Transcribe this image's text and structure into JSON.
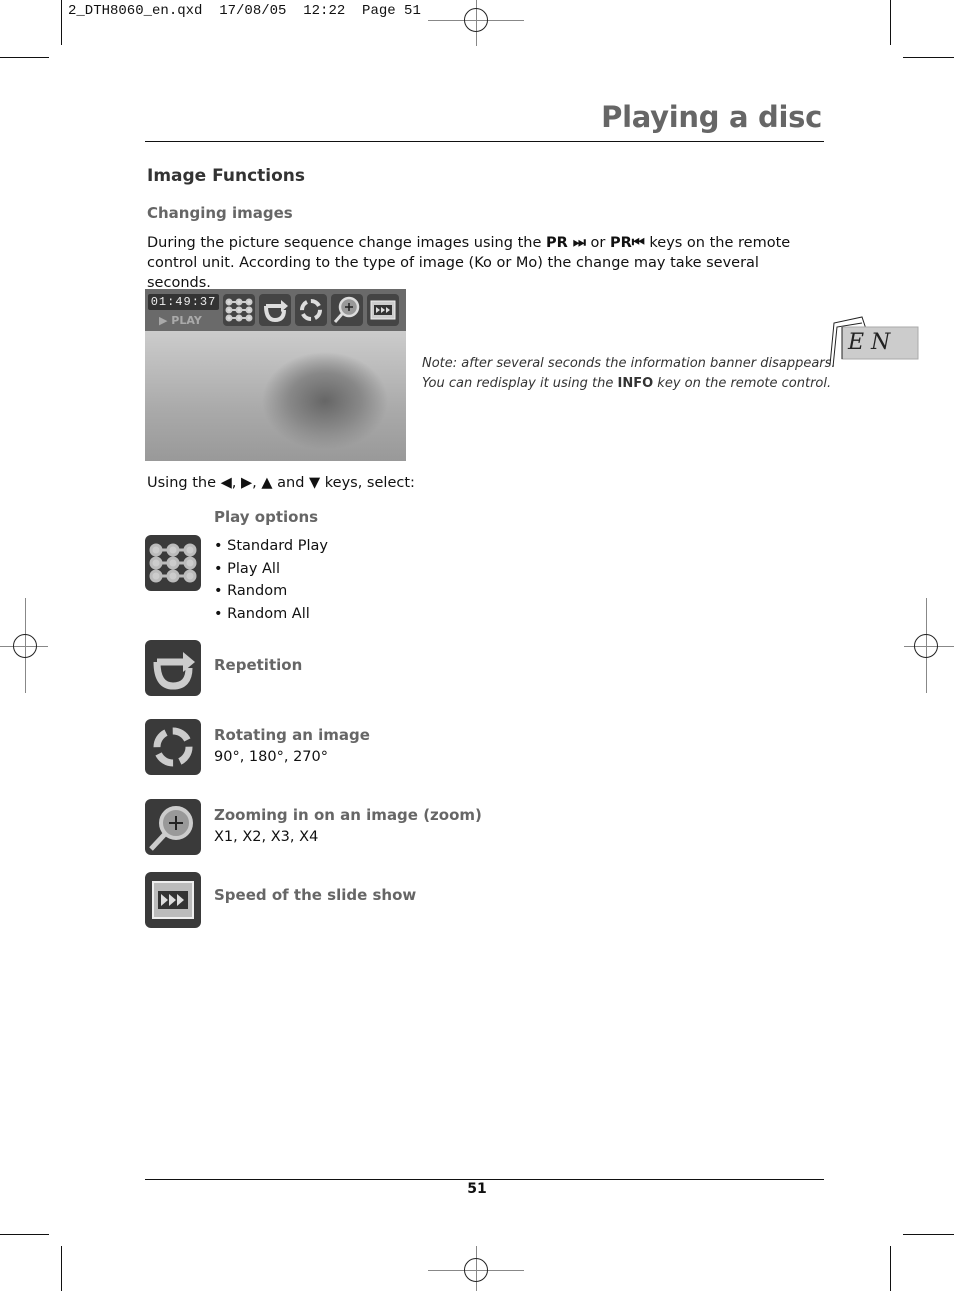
{
  "slug": {
    "text": "2_DTH8060_en.qxd  17/08/05  12:22  Page 51"
  },
  "header": {
    "title": "Playing a disc"
  },
  "section": {
    "title": "Image Functions"
  },
  "changing": {
    "title": "Changing images",
    "line1_pre": "During the picture sequence change images using the ",
    "key1": "PR ⏭",
    "line1_mid": " or ",
    "key2": "PR⏮",
    "line1_post": " keys on the remote",
    "line2": "control unit. According to the type of image (Ko or Mo) the change may take several seconds."
  },
  "screen": {
    "time": "01:49:37",
    "status": "▶ PLAY"
  },
  "note": {
    "line1": "Note: after several seconds the information banner disappears.",
    "line2_pre": "You can redisplay it using the ",
    "line2_key": "INFO",
    "line2_post": " key on the remote control."
  },
  "lang_tab": {
    "label": "E N"
  },
  "using": {
    "pre": "Using the ",
    "k1": "◀",
    "sep1": ", ",
    "k2": "▶",
    "sep2": ", ",
    "k3": "▲",
    "and": " and ",
    "k4": "▼",
    "post": " keys, select:"
  },
  "functions": [
    {
      "title": "Play options",
      "icon": "play-options-icon",
      "items": [
        "• Standard Play",
        "• Play All",
        "• Random",
        "• Random All"
      ]
    },
    {
      "title": "Repetition",
      "icon": "repeat-icon"
    },
    {
      "title": "Rotating an image",
      "icon": "rotate-icon",
      "detail": "90°, 180°, 270°"
    },
    {
      "title": "Zooming in on an image (zoom)",
      "icon": "zoom-icon",
      "detail": "X1, X2, X3, X4"
    },
    {
      "title": "Speed of the slide show",
      "icon": "speed-icon"
    }
  ],
  "footer": {
    "page": "51"
  }
}
